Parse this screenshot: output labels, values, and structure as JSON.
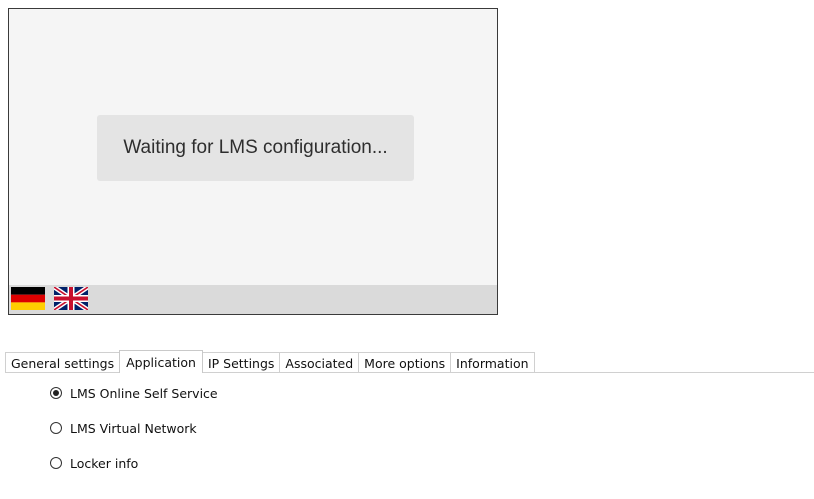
{
  "preview": {
    "status_message": "Waiting for LMS configuration...",
    "languages": [
      {
        "icon": "german-flag-icon"
      },
      {
        "icon": "uk-flag-icon"
      }
    ]
  },
  "tabs": [
    {
      "label": "General settings",
      "active": false
    },
    {
      "label": "Application",
      "active": true
    },
    {
      "label": "IP Settings",
      "active": false
    },
    {
      "label": "Associated",
      "active": false
    },
    {
      "label": "More options",
      "active": false
    },
    {
      "label": "Information",
      "active": false
    }
  ],
  "application_options": [
    {
      "label": "LMS Online Self Service",
      "selected": true
    },
    {
      "label": "LMS Virtual Network",
      "selected": false
    },
    {
      "label": "Locker info",
      "selected": false
    }
  ]
}
